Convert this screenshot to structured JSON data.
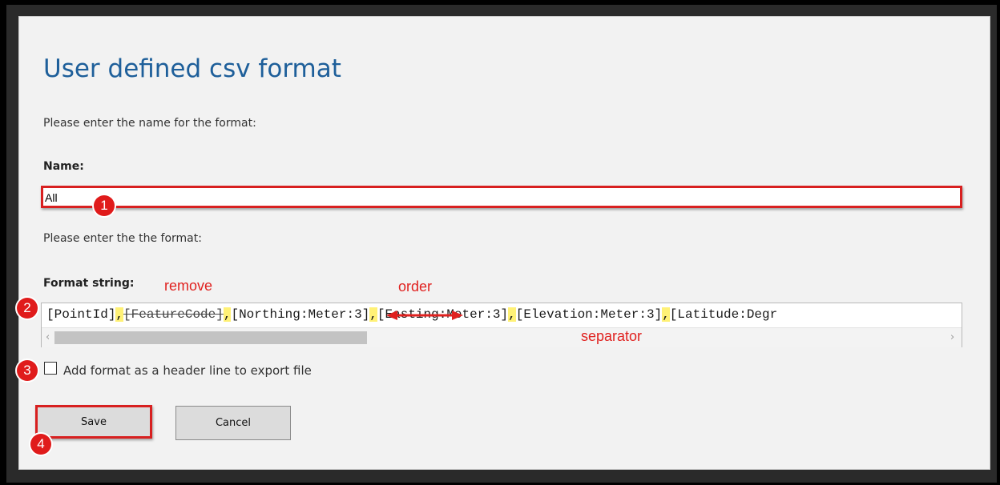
{
  "dialog": {
    "title": "User defined csv format",
    "name_prompt": "Please enter the name for the format:",
    "name_label": "Name:",
    "name_value": "All",
    "format_prompt": "Please enter the the format:",
    "format_label": "Format string:",
    "format_segments": {
      "point_id": "[PointId]",
      "sep1": ",",
      "feature_code": "[FeatureCode]",
      "sep2": ",",
      "northing": "[Northing:Meter:3]",
      "sep3": ",",
      "easting": "[Easting:Meter:3]",
      "sep4": ",",
      "elevation": "[Elevation:Meter:3]",
      "sep5": ",",
      "latitude": "[Latitude:Degr"
    },
    "header_checkbox_label": "Add format as a header line to export file",
    "header_checkbox_checked": false,
    "save_label": "Save",
    "cancel_label": "Cancel"
  },
  "annotations": {
    "remove": "remove",
    "order": "order",
    "separator": "separator",
    "badge1": "1",
    "badge2": "2",
    "badge3": "3",
    "badge4": "4",
    "color": "#e0211f"
  },
  "icons": {
    "scroll_left": "chevron-left-icon",
    "scroll_right": "chevron-right-icon",
    "order_arrow": "double-arrow-icon"
  }
}
